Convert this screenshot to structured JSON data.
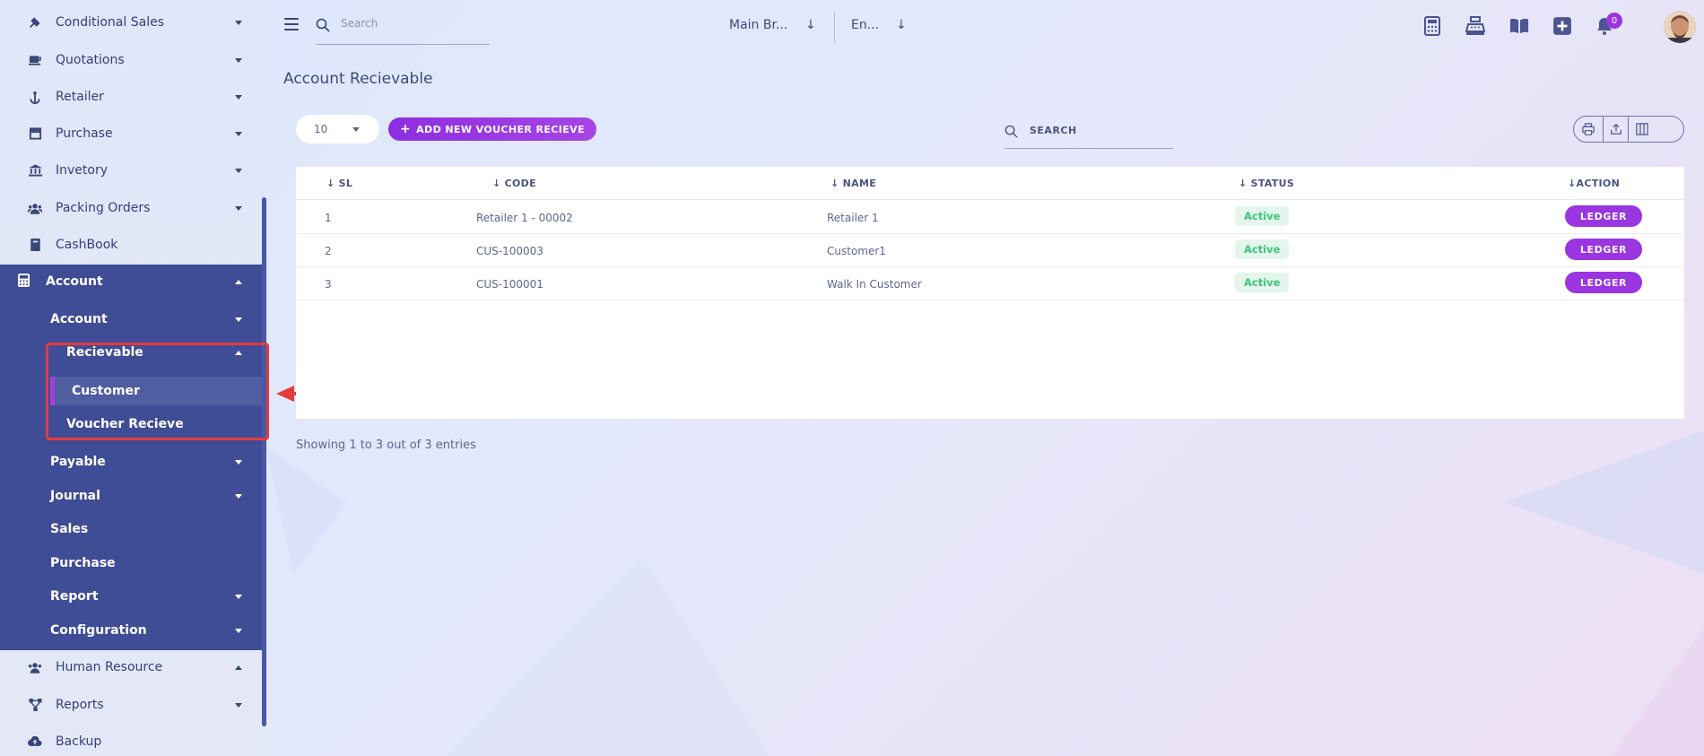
{
  "sidebar": {
    "top_items": [
      {
        "label": "Conditional Sales",
        "icon": "hammer-icon"
      },
      {
        "label": "Quotations",
        "icon": "coffee-icon"
      },
      {
        "label": "Retailer",
        "icon": "anchor-icon"
      },
      {
        "label": "Purchase",
        "icon": "store-icon"
      },
      {
        "label": "Invetory",
        "icon": "bank-icon"
      },
      {
        "label": "Packing Orders",
        "icon": "users-icon"
      },
      {
        "label": "CashBook",
        "icon": "book-icon"
      }
    ],
    "account": {
      "label": "Account",
      "sub": {
        "account": "Account",
        "recievable": "Recievable",
        "customer": "Customer",
        "voucher_recieve": "Voucher Recieve",
        "payable": "Payable",
        "journal": "Journal",
        "sales": "Sales",
        "purchase": "Purchase",
        "report": "Report",
        "configuration": "Configuration"
      }
    },
    "bottom_items": [
      {
        "label": "Human Resource",
        "icon": "users-icon"
      },
      {
        "label": "Reports",
        "icon": "network-icon"
      },
      {
        "label": "Backup",
        "icon": "cloud-upload-icon"
      }
    ]
  },
  "topbar": {
    "search_placeholder": "Search",
    "branch": "Main Br...",
    "language": "En...",
    "notification_count": "0"
  },
  "main": {
    "title": "Account Recievable",
    "page_size": "10",
    "add_button": "ADD NEW VOUCHER RECIEVE",
    "search_placeholder": "SEARCH",
    "columns": {
      "sl": "SL",
      "code": "CODE",
      "name": "NAME",
      "status": "STATUS",
      "action": "ACTION"
    },
    "rows": [
      {
        "sl": "1",
        "code": "Retailer 1 - 00002",
        "name": "Retailer 1",
        "status": "Active",
        "action": "LEDGER"
      },
      {
        "sl": "2",
        "code": "CUS-100003",
        "name": "Customer1",
        "status": "Active",
        "action": "LEDGER"
      },
      {
        "sl": "3",
        "code": "CUS-100001",
        "name": "Walk In Customer",
        "status": "Active",
        "action": "LEDGER"
      }
    ],
    "footer": "Showing 1 to 3 out of 3 entries"
  },
  "colors": {
    "accent": "#9a35e0",
    "sidebar_active": "#3f4c96",
    "status_active": "#3cc47a",
    "annotation": "#e23b3b"
  }
}
